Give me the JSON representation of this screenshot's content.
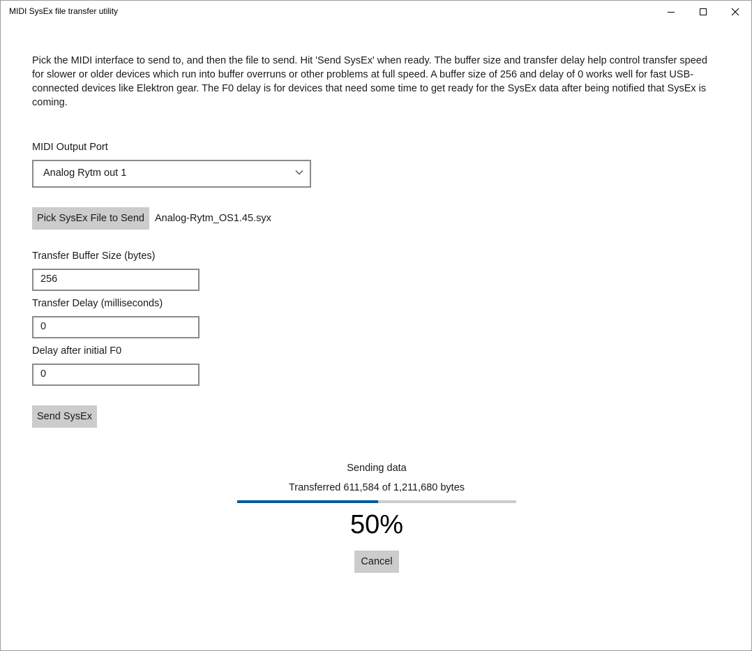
{
  "window": {
    "title": "MIDI SysEx file transfer utility"
  },
  "intro_text": "Pick the MIDI interface to send to, and then the file to send. Hit 'Send SysEx' when ready. The buffer size and transfer delay help control transfer speed for slower or older devices which run into buffer overruns or other problems at full speed. A buffer size of 256 and delay of 0 works well for fast USB-connected devices like Elektron gear. The F0 delay is for devices that need some time to get ready for the SysEx data after being notified that SysEx is coming.",
  "midi_output": {
    "label": "MIDI Output Port",
    "selected": "Analog Rytm out 1"
  },
  "file_picker": {
    "button_label": "Pick SysEx File to Send",
    "file_name": "Analog-Rytm_OS1.45.syx"
  },
  "buffer_size": {
    "label": "Transfer Buffer Size (bytes)",
    "value": "256"
  },
  "transfer_delay": {
    "label": "Transfer Delay (milliseconds)",
    "value": "0"
  },
  "f0_delay": {
    "label": "Delay after initial F0",
    "value": "0"
  },
  "send_button_label": "Send SysEx",
  "progress": {
    "status": "Sending data",
    "detail": "Transferred 611,584 of 1,211,680 bytes",
    "fraction": 0.505,
    "percent_text": "50%",
    "cancel_label": "Cancel"
  },
  "colors": {
    "progress_fill": "#005a9e",
    "progress_track": "#cccccc",
    "button_bg": "#cccccc"
  }
}
